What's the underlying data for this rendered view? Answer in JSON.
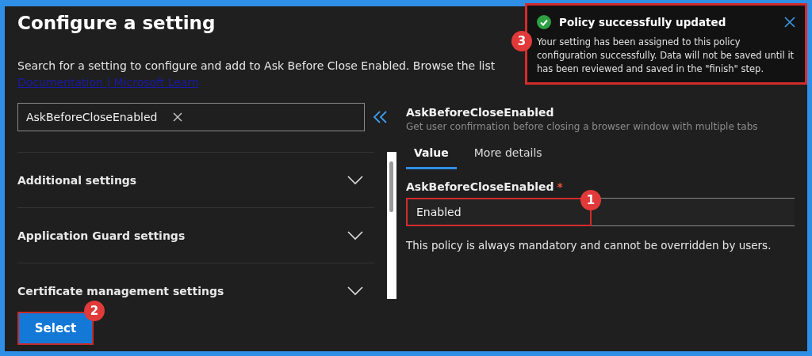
{
  "title": "Configure a setting",
  "description": "Search for a setting to configure and add to Ask Before Close Enabled. Browse the list",
  "link": "Documentation | Microsoft Learn",
  "search": {
    "value": "AskBeforeCloseEnabled"
  },
  "categories": [
    {
      "label": "Additional settings",
      "expanded": false
    },
    {
      "label": "Application Guard settings",
      "expanded": false
    },
    {
      "label": "Certificate management settings",
      "expanded": false
    }
  ],
  "setting": {
    "name": "AskBeforeCloseEnabled",
    "description": "Get user confirmation before closing a browser window with multiple tabs",
    "tabs": [
      {
        "label": "Value",
        "selected": true
      },
      {
        "label": "More details",
        "selected": false
      }
    ],
    "field_label": "AskBeforeCloseEnabled",
    "required_mark": "*",
    "value": "Enabled",
    "callout": "1",
    "note": "This policy is always mandatory and cannot be overridden by users."
  },
  "button": {
    "label": "Select",
    "callout": "2"
  },
  "toast": {
    "title": "Policy successfully updated",
    "message": "Your setting has been assigned to this policy configuration successfully. Data will not be saved until it has been reviewed and saved in the \"finish\" step.",
    "callout": "3"
  }
}
